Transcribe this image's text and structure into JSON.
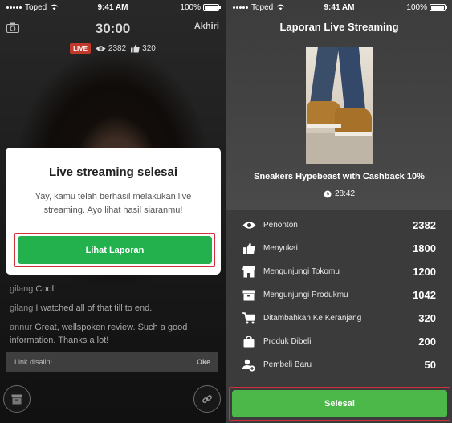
{
  "left_screen": {
    "status": {
      "carrier": "Toped",
      "time": "9:41 AM",
      "battery": "100%"
    },
    "timer": "30:00",
    "end_label": "Akhiri",
    "live_badge": "LIVE",
    "viewers": "2382",
    "likes": "320",
    "modal": {
      "title": "Live streaming selesai",
      "message": "Yay, kamu telah berhasil melakukan live streaming. Ayo lihat hasil siaranmu!",
      "button": "Lihat Laporan"
    },
    "comments": [
      {
        "user": "gilang",
        "text": "Cool!"
      },
      {
        "user": "gilang",
        "text": "I watched all of that till to end."
      },
      {
        "user": "annur",
        "text": "Great, wellspoken review. Such a good information. Thanks a lot!"
      }
    ],
    "toast": {
      "message": "Link disalin!",
      "action": "Oke"
    }
  },
  "right_screen": {
    "status": {
      "carrier": "Toped",
      "time": "9:41 AM",
      "battery": "100%"
    },
    "title": "Laporan Live Streaming",
    "product_name": "Sneakers Hypebeast with Cashback 10%",
    "duration": "28:42",
    "stats": [
      {
        "label": "Penonton",
        "value": "2382",
        "icon": "eye-icon"
      },
      {
        "label": "Menyukai",
        "value": "1800",
        "icon": "thumbs-up-icon"
      },
      {
        "label": "Mengunjungi Tokomu",
        "value": "1200",
        "icon": "store-icon"
      },
      {
        "label": "Mengunjungi Produkmu",
        "value": "1042",
        "icon": "box-icon"
      },
      {
        "label": "Ditambahkan Ke Keranjang",
        "value": "320",
        "icon": "cart-icon"
      },
      {
        "label": "Produk Dibeli",
        "value": "200",
        "icon": "bag-icon"
      },
      {
        "label": "Pembeli Baru",
        "value": "50",
        "icon": "new-buyer-icon"
      }
    ],
    "done_button": "Selesai"
  },
  "colors": {
    "primary_green": "#22b14c",
    "live_red": "#c0392b",
    "highlight_border": "#d0303b"
  }
}
